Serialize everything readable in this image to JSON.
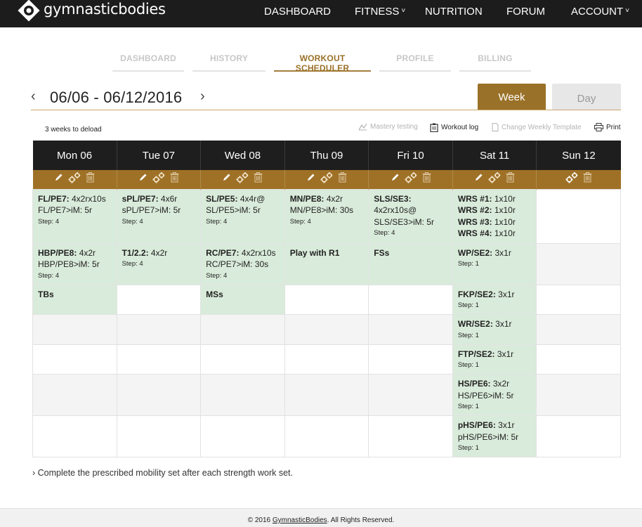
{
  "brand": {
    "name": "gymnasticbodies"
  },
  "topnav": [
    {
      "label": "DASHBOARD",
      "caret": ""
    },
    {
      "label": "FITNESS",
      "caret": "˅"
    },
    {
      "label": "NUTRITION",
      "caret": ""
    },
    {
      "label": "FORUM",
      "caret": ""
    },
    {
      "label": "ACCOUNT",
      "caret": "˅"
    }
  ],
  "subtabs": [
    "DASHBOARD",
    "HISTORY",
    "WORKOUT SCHEDULER",
    "PROFILE",
    "BILLING"
  ],
  "active_subtab": "WORKOUT SCHEDULER",
  "date_range": "06/06 - 06/12/2016",
  "prev_arrow": "‹",
  "next_arrow": "›",
  "view_toggle": {
    "week": "Week",
    "day": "Day",
    "selected": "Week"
  },
  "deload_text": "3 weeks to deload",
  "tools": {
    "mastery": "Mastery testing",
    "workout_log": "Workout log",
    "change_template": "Change Weekly Template",
    "print": "Print"
  },
  "days": [
    "Mon 06",
    "Tue 07",
    "Wed 08",
    "Thu 09",
    "Fri 10",
    "Sat 11",
    "Sun 12"
  ],
  "rows": [
    [
      {
        "lines": [
          {
            "b": "FL/PE7:",
            "t": " 4x2rx10s"
          },
          {
            "b": "",
            "t": "FL/PE7>iM: 5r"
          }
        ],
        "step": "Step: 4"
      },
      {
        "lines": [
          {
            "b": "sPL/PE7:",
            "t": " 4x6r"
          },
          {
            "b": "",
            "t": "sPL/PE7>iM: 5r"
          }
        ],
        "step": "Step: 4"
      },
      {
        "lines": [
          {
            "b": "SL/PE5:",
            "t": " 4x4r@"
          },
          {
            "b": "",
            "t": "SL/PE5>iM: 5r"
          }
        ],
        "step": "Step: 4"
      },
      {
        "lines": [
          {
            "b": "MN/PE8:",
            "t": " 4x2r"
          },
          {
            "b": "",
            "t": "MN/PE8>iM: 30s"
          }
        ],
        "step": "Step: 4"
      },
      {
        "lines": [
          {
            "b": "SLS/SE3:",
            "t": ""
          },
          {
            "b": "",
            "t": "4x2rx10s@"
          },
          {
            "b": "",
            "t": "SLS/SE3>iM: 5r"
          }
        ],
        "step": "Step: 4"
      },
      {
        "lines": [
          {
            "b": "WRS #1:",
            "t": " 1x10r"
          },
          {
            "b": "WRS #2:",
            "t": " 1x10r"
          },
          {
            "b": "WRS #3:",
            "t": " 1x10r"
          },
          {
            "b": "WRS #4:",
            "t": " 1x10r"
          }
        ],
        "step": ""
      },
      null
    ],
    [
      {
        "lines": [
          {
            "b": "HBP/PE8:",
            "t": " 4x2r"
          },
          {
            "b": "",
            "t": "HBP/PE8>iM: 5r"
          }
        ],
        "step": "Step: 4"
      },
      {
        "lines": [
          {
            "b": "T1/2.2:",
            "t": " 4x2r"
          }
        ],
        "step": "Step: 4"
      },
      {
        "lines": [
          {
            "b": "RC/PE7:",
            "t": " 4x2rx10s"
          },
          {
            "b": "",
            "t": "RC/PE7>iM: 30s"
          }
        ],
        "step": "Step: 4"
      },
      {
        "lines": [
          {
            "b": "Play with R1",
            "t": ""
          }
        ],
        "step": ""
      },
      {
        "lines": [
          {
            "b": "FSs",
            "t": ""
          }
        ],
        "step": ""
      },
      {
        "lines": [
          {
            "b": "WP/SE2:",
            "t": " 3x1r"
          }
        ],
        "step": "Step: 1"
      },
      null
    ],
    [
      {
        "lines": [
          {
            "b": "TBs",
            "t": ""
          }
        ],
        "step": ""
      },
      null,
      {
        "lines": [
          {
            "b": "MSs",
            "t": ""
          }
        ],
        "step": ""
      },
      null,
      null,
      {
        "lines": [
          {
            "b": "FKP/SE2:",
            "t": " 3x1r"
          }
        ],
        "step": "Step: 1"
      },
      null
    ],
    [
      null,
      null,
      null,
      null,
      null,
      {
        "lines": [
          {
            "b": "WR/SE2:",
            "t": " 3x1r"
          }
        ],
        "step": "Step: 1"
      },
      null
    ],
    [
      null,
      null,
      null,
      null,
      null,
      {
        "lines": [
          {
            "b": "FTP/SE2:",
            "t": " 3x1r"
          }
        ],
        "step": "Step: 1"
      },
      null
    ],
    [
      null,
      null,
      null,
      null,
      null,
      {
        "lines": [
          {
            "b": "HS/PE6:",
            "t": " 3x2r"
          },
          {
            "b": "",
            "t": "HS/PE6>iM: 5r"
          }
        ],
        "step": "Step: 1"
      },
      null
    ],
    [
      null,
      null,
      null,
      null,
      null,
      {
        "lines": [
          {
            "b": "pHS/PE6:",
            "t": " 3x1r"
          },
          {
            "b": "",
            "t": "pHS/PE6>iM: 5r"
          }
        ],
        "step": "Step: 1"
      },
      null
    ]
  ],
  "note": "› Complete the prescribed mobility set after each strength work set.",
  "footer": {
    "prefix": "© 2016 ",
    "link": "GymnasticBodies",
    "suffix": ". All Rights Reserved."
  },
  "colors": {
    "accent": "#9a7128",
    "header_bg": "#1e1e1e",
    "filled_cell": "#d9ebda",
    "alt_row": "#f4f4f4"
  }
}
